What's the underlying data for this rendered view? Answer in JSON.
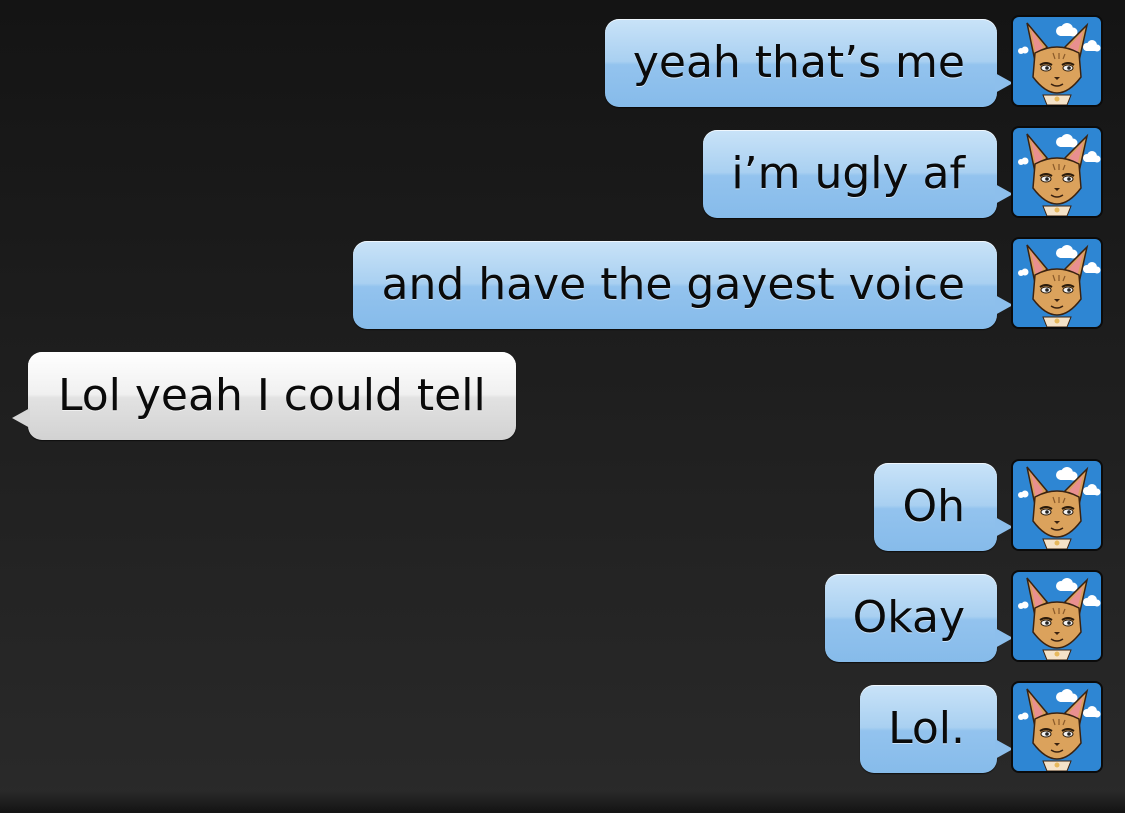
{
  "conversation": {
    "messages": [
      {
        "sender": "me",
        "text": "yeah that’s me",
        "avatar_icon": "fox-character-avatar-icon"
      },
      {
        "sender": "me",
        "text": "i’m ugly af",
        "avatar_icon": "fox-character-avatar-icon"
      },
      {
        "sender": "me",
        "text": "and have the gayest voice",
        "avatar_icon": "fox-character-avatar-icon"
      },
      {
        "sender": "other",
        "text": "Lol yeah I could tell"
      },
      {
        "sender": "me",
        "text": "Oh",
        "avatar_icon": "fox-character-avatar-icon"
      },
      {
        "sender": "me",
        "text": "Okay",
        "avatar_icon": "fox-character-avatar-icon"
      },
      {
        "sender": "me",
        "text": "Lol.",
        "avatar_icon": "fox-character-avatar-icon"
      }
    ]
  },
  "colors": {
    "background": "#1e1e1e",
    "outgoing_bubble": "#a9d0f1",
    "incoming_bubble": "#e6e6e6",
    "avatar_sky": "#2e86d3"
  }
}
